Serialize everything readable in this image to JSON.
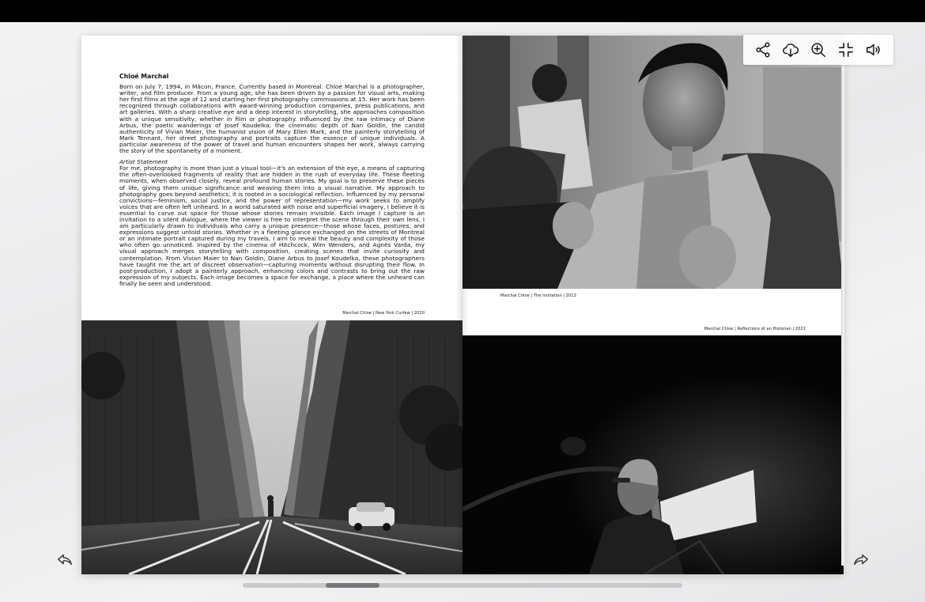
{
  "bio": {
    "name": "Chloé Marchal",
    "text": "Born on July 7, 1994, in Mâcon, France. Currently based in Montreal. Chloé Marchal is a photographer, writer, and film producer. From a young age, she has been driven by a passion for visual arts, making her first films at the age of 12 and starting her first photography commissions at 15. Her work has been recognized through collaborations with award-winning production companies, press publications, and art galleries. With a sharp creative eye and a deep interest in storytelling, she approaches composition with a unique sensitivity, whether in film or photography. Influenced by the raw intimacy of Diane Arbus, the poetic wanderings of Josef Koudelka, the cinematic depth of Nan Goldin, the candid authenticity of Vivian Maier, the humanist vision of Mary Ellen Mark, and the painterly storytelling of Mark Tennant, her street photography and portraits capture the essence of unique individuals. A particular awareness of the power of travel and human encounters shapes her work, always carrying the story of the spontaneity of a moment.",
    "statement_title": "Artist Statement",
    "statement_text": "For me, photography is more than just a visual tool—it's an extension of the eye, a means of capturing the often-overlooked fragments of reality that are hidden in the rush of everyday life. These fleeting moments, when observed closely, reveal profound human stories. My goal is to preserve these pieces of life, giving them unique significance and weaving them into a visual narrative. My approach to photography goes beyond aesthetics; it is rooted in a sociological reflection. Influenced by my personal convictions—feminism, social justice, and the power of representation—my work seeks to amplify voices that are often left unheard. In a world saturated with noise and superficial imagery, I believe it is essential to carve out space for those whose stories remain invisible. Each image I capture is an invitation to a silent dialogue, where the viewer is free to interpret the scene through their own lens. I am particularly drawn to individuals who carry a unique presence—those whose faces, postures, and expressions suggest untold stories. Whether in a fleeting glance exchanged on the streets of Montreal or an intimate portrait captured during my travels, I aim to reveal the beauty and complexity of those who often go unnoticed. Inspired by the cinema of Hitchcock, Wim Wenders, and Agnès Varda, my visual approach merges storytelling with composition, creating scenes that invite curiosity and contemplation. From Vivian Maier to Nan Goldin, Diane Arbus to Josef Koudelka, these photographers have taught me the art of discreet observation—capturing moments without disrupting their flow. In post-production, I adopt a painterly approach, enhancing colors and contrasts to bring out the raw expression of my subjects. Each image becomes a space for exchange, a place where the unheard can finally be seen and understood."
  },
  "captions": {
    "left": "Marchal Chloe | New York Curfew | 2020",
    "right_top": "Marchal Chloe | The Invitation | 2013",
    "right_bottom": "Marchal Chloe | Reflections of an Historian | 2021"
  },
  "toolbar": {
    "icons": [
      "share-icon",
      "cloud-download-icon",
      "zoom-in-icon",
      "exit-fullscreen-icon",
      "volume-icon"
    ]
  },
  "navigation": {
    "prev_icon": "arrow-back-icon",
    "next_icon": "arrow-forward-icon"
  },
  "colors": {
    "top_bar": "#000000",
    "page": "#ffffff",
    "scroll_track": "#c9c9cc",
    "scroll_thumb": "#77777c"
  }
}
